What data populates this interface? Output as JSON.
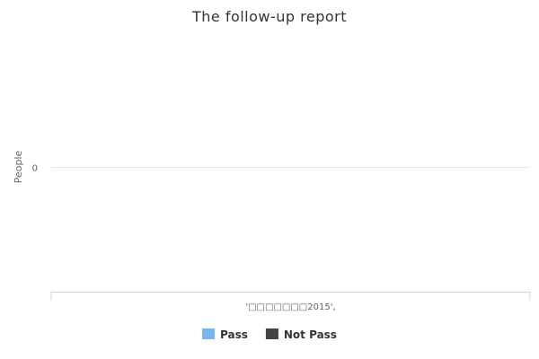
{
  "chart_data": {
    "type": "bar",
    "title": "The follow-up report",
    "ylabel": "People",
    "xlabel": "",
    "categories": [
      "'□□□□□□□2015',"
    ],
    "series": [
      {
        "name": "Pass",
        "values": [
          0
        ],
        "color": "#7cb5ec"
      },
      {
        "name": "Not Pass",
        "values": [
          0
        ],
        "color": "#434348"
      }
    ],
    "y_ticks": [
      0
    ],
    "ylim": [
      -1,
      1
    ],
    "grid": true,
    "legend": "bottom-center"
  }
}
